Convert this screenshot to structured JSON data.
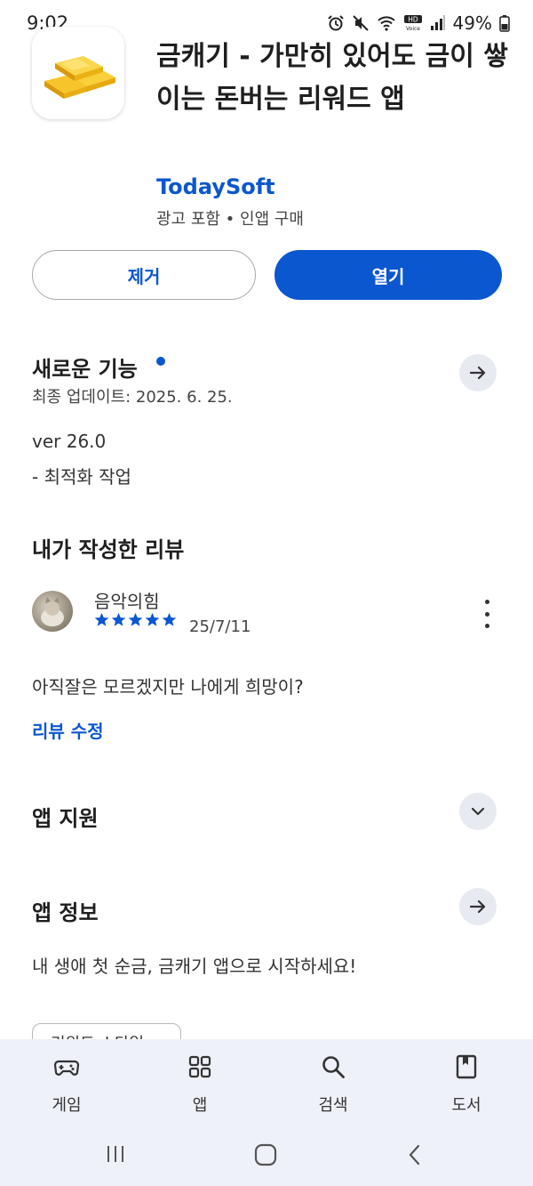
{
  "status_bar": {
    "time": "9:02",
    "battery": "49%"
  },
  "app": {
    "title": "금캐기 - 가만히 있어도 금이 쌓이는 돈버는 리워드 앱",
    "developer": "TodaySoft",
    "meta": "광고 포함 • 인앱 구매"
  },
  "actions": {
    "remove_label": "제거",
    "open_label": "열기"
  },
  "whats_new": {
    "title": "새로운 기능",
    "updated": "최종 업데이트: 2025. 6. 25.",
    "version": "ver 26.0",
    "note": "- 최적화 작업"
  },
  "my_review": {
    "title": "내가 작성한 리뷰",
    "author": "음악의힘",
    "rating": 5,
    "date": "25/7/11",
    "text": "아직잘은 모르겠지만 나에게 희망이?",
    "edit_label": "리뷰 수정"
  },
  "app_support": {
    "title": "앱 지원"
  },
  "app_info": {
    "title": "앱 정보",
    "description": "내 생애 첫 순금, 금캐기 앱으로 시작하세요!",
    "chip_label": "리워드 스타일"
  },
  "bottom_nav": {
    "items": [
      {
        "label": "게임",
        "icon": "gamepad-icon"
      },
      {
        "label": "앱",
        "icon": "apps-grid-icon"
      },
      {
        "label": "검색",
        "icon": "search-icon"
      },
      {
        "label": "도서",
        "icon": "book-icon"
      }
    ]
  },
  "colors": {
    "accent": "#0b57d0",
    "nav_bg": "#eef1f8",
    "circle_btn": "#e8eaf2"
  }
}
